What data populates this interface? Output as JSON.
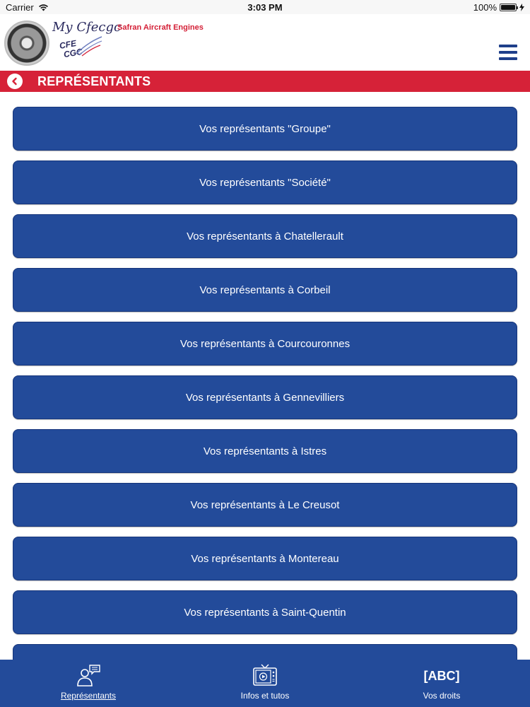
{
  "status_bar": {
    "carrier": "Carrier",
    "time": "3:03 PM",
    "battery_percent": "100%",
    "battery_level": 1.0
  },
  "header": {
    "brand_title": "My Cfecgc",
    "brand_subtitle": "Safran Aircraft Engines",
    "logo_line1": "CFE",
    "logo_line2": "CGC"
  },
  "page": {
    "title": "REPRÉSENTANTS"
  },
  "representatives": [
    {
      "label": "Vos représentants \"Groupe\""
    },
    {
      "label": "Vos représentants \"Société\""
    },
    {
      "label": "Vos représentants à Chatellerault"
    },
    {
      "label": "Vos représentants à Corbeil"
    },
    {
      "label": "Vos représentants à Courcouronnes"
    },
    {
      "label": "Vos représentants à Gennevilliers"
    },
    {
      "label": "Vos représentants à Istres"
    },
    {
      "label": "Vos représentants à Le Creusot"
    },
    {
      "label": "Vos représentants à Montereau"
    },
    {
      "label": "Vos représentants à Saint-Quentin"
    },
    {
      "label": ""
    }
  ],
  "tabs": [
    {
      "label": "Représentants",
      "icon": "representatives-icon",
      "active": true
    },
    {
      "label": "Infos et tutos",
      "icon": "video-tv-icon",
      "active": false
    },
    {
      "label": "Vos droits",
      "icon_text": "[ABC]",
      "active": false
    }
  ],
  "colors": {
    "accent_red": "#d62238",
    "primary_blue": "#234b9a"
  }
}
